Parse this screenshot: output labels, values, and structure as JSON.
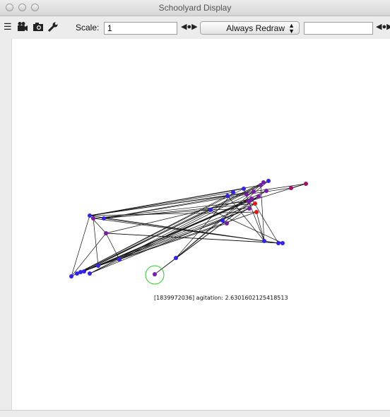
{
  "window": {
    "title": "Schoolyard Display"
  },
  "toolbar": {
    "scale_label": "Scale:",
    "scale_value": "1",
    "redraw_label": "Always Redraw",
    "icons": [
      "layers-icon",
      "video-camera-icon",
      "camera-icon",
      "wrench-icon"
    ]
  },
  "display": {
    "caption": "[1839972036] agitation: 2.6301602125418513",
    "colors": {
      "blue": "#3322ee",
      "purple": "#7a1aa8",
      "red": "#e01818",
      "magenta": "#a0106a",
      "highlight": "#22cc22"
    }
  }
}
